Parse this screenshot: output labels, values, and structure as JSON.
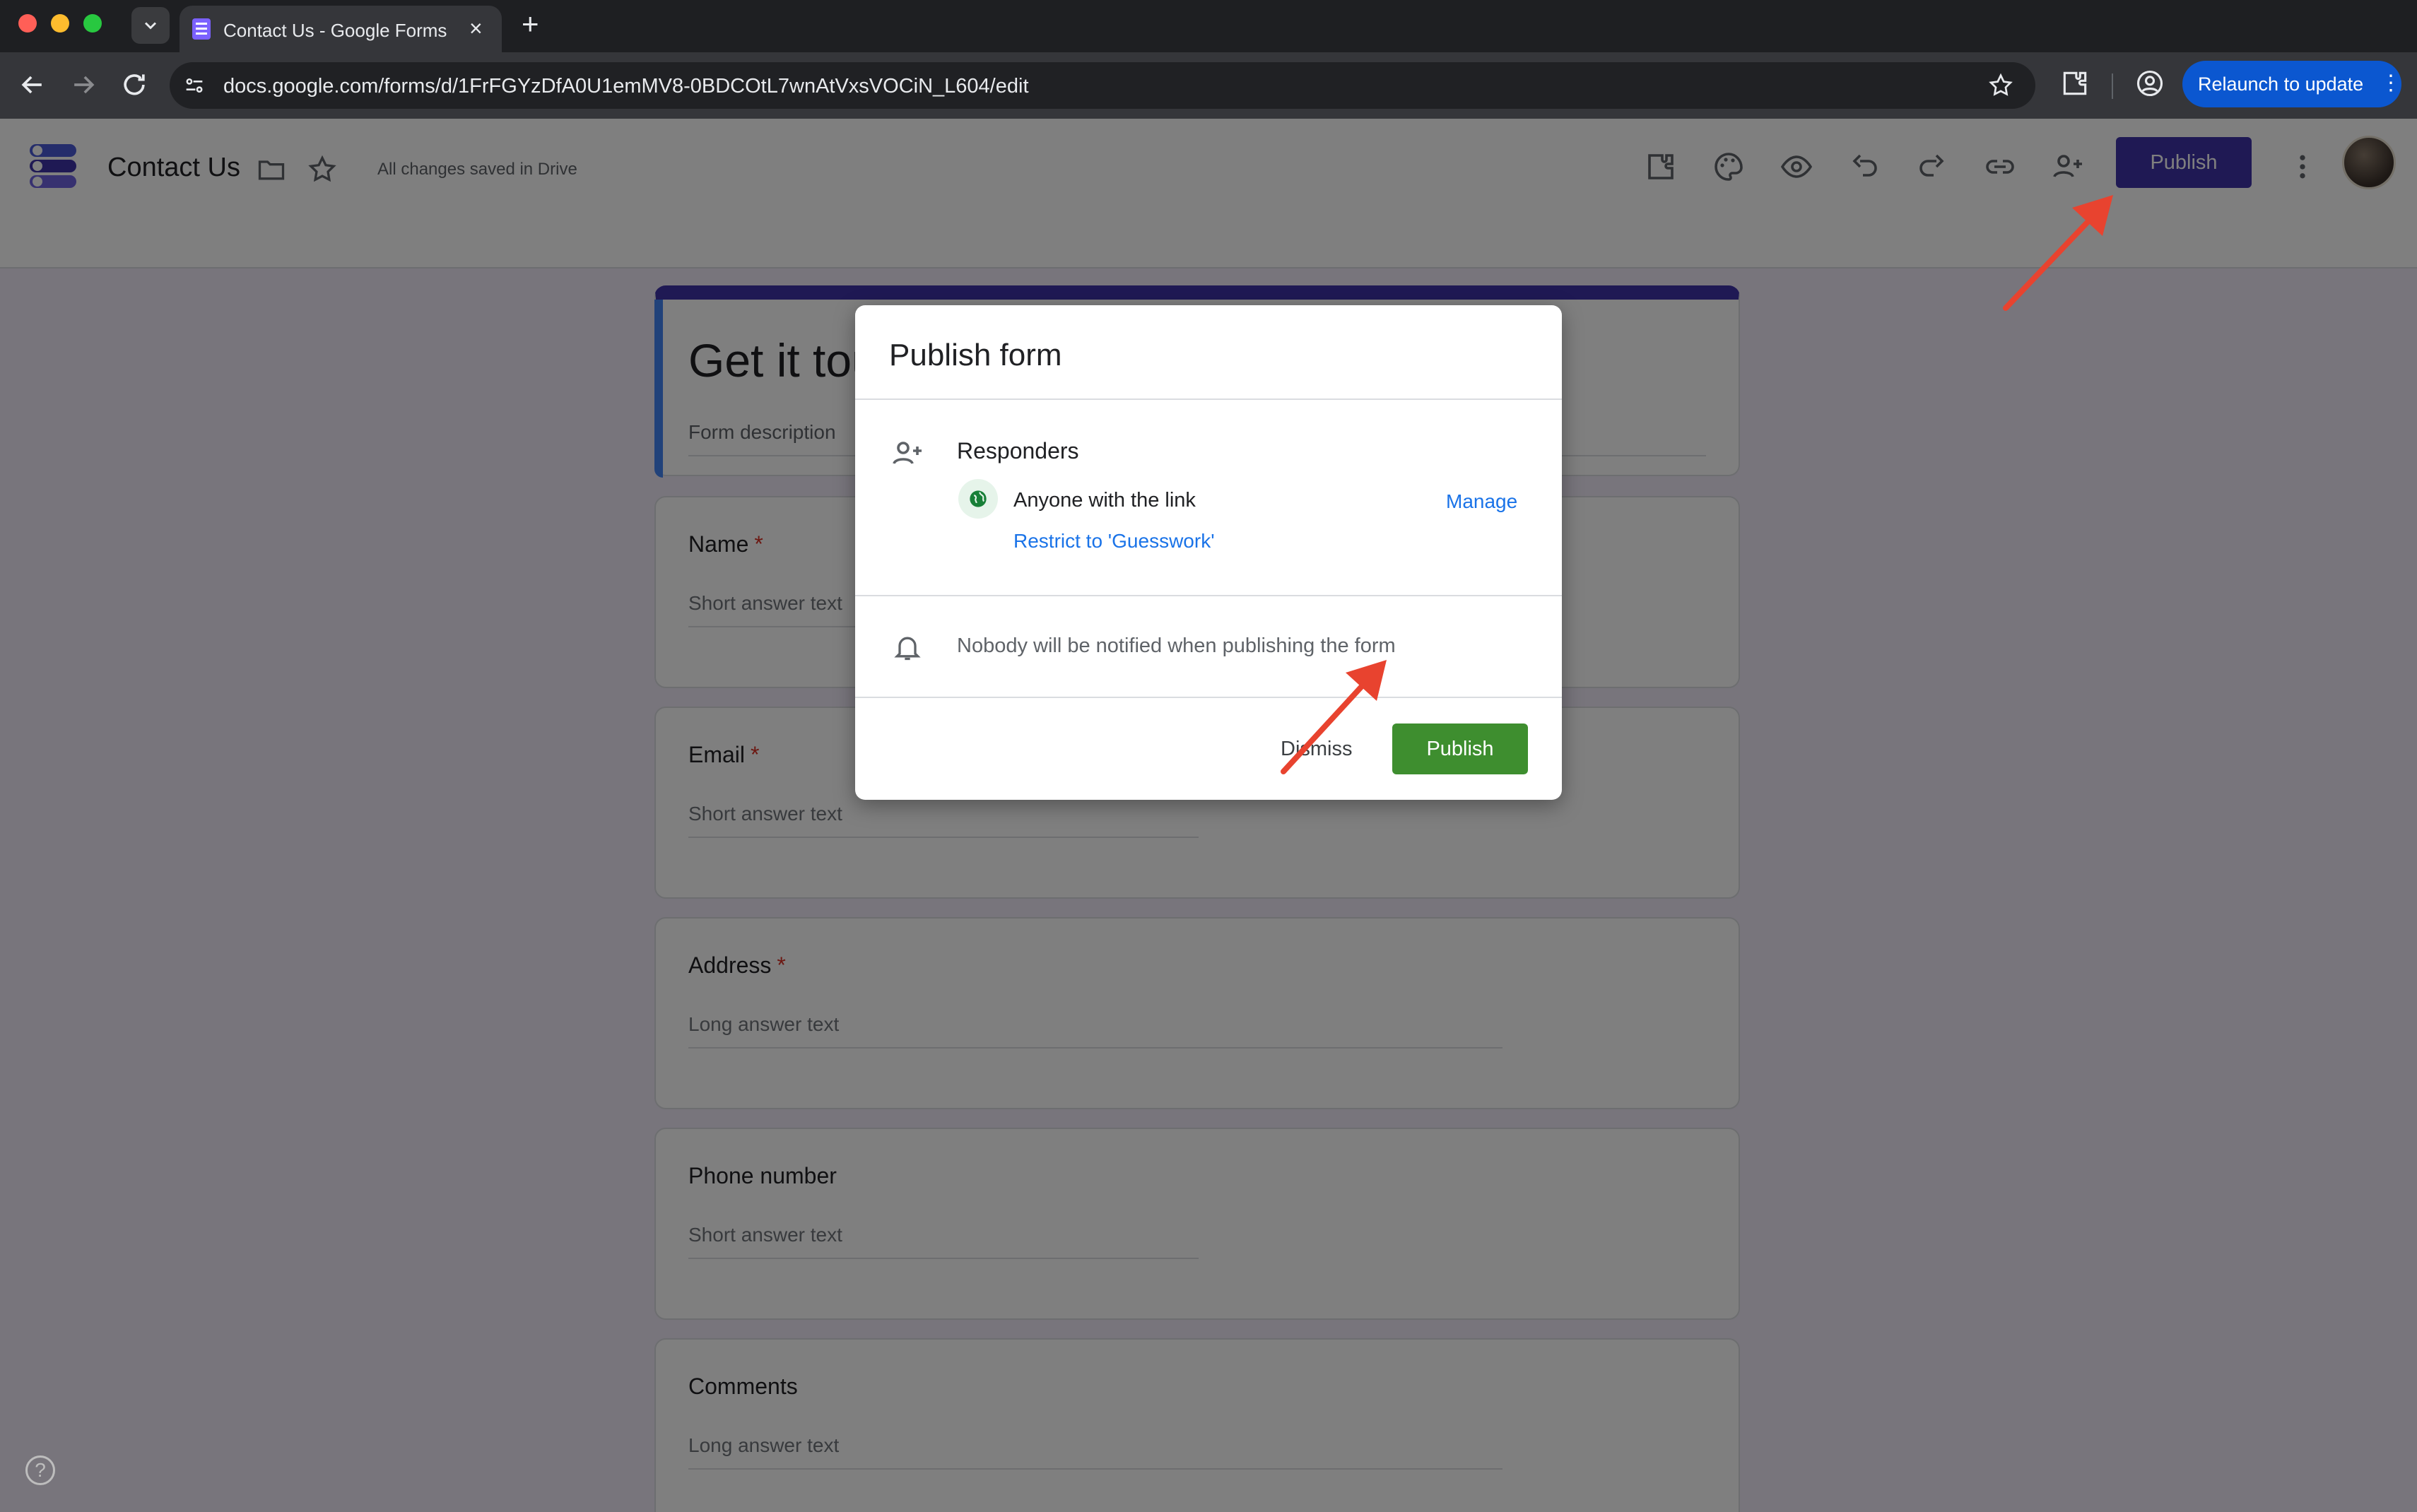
{
  "browser": {
    "tab_title": "Contact Us - Google Forms",
    "url": "docs.google.com/forms/d/1FrFGYzDfA0U1emMV8-0BDCOtL7wnAtVxsVOCiN_L604/edit",
    "relaunch_label": "Relaunch to update"
  },
  "forms_header": {
    "doc_title": "Contact Us",
    "save_status": "All changes saved in Drive",
    "publish_label": "Publish"
  },
  "form": {
    "title": "Get it tou",
    "description_placeholder": "Form description",
    "questions": [
      {
        "label": "Name",
        "required": "*",
        "hint": "Short answer text"
      },
      {
        "label": "Email",
        "required": "*",
        "hint": "Short answer text"
      },
      {
        "label": "Address",
        "required": "*",
        "hint": "Long answer text"
      },
      {
        "label": "Phone number",
        "required": "",
        "hint": "Short answer text"
      },
      {
        "label": "Comments",
        "required": "",
        "hint": "Long answer text"
      }
    ]
  },
  "dialog": {
    "title": "Publish form",
    "responders_heading": "Responders",
    "access_label": "Anyone with the link",
    "manage_label": "Manage",
    "restrict_label": "Restrict to 'Guesswork'",
    "notify_text": "Nobody will be notified when publishing the form",
    "dismiss_label": "Dismiss",
    "publish_label": "Publish"
  },
  "help": {
    "label": "?"
  },
  "colors": {
    "publish_top": "#3e33a8",
    "publish_dialog": "#3e8e2f",
    "annotation_arrow": "#e8432f",
    "link": "#1a73e8"
  }
}
